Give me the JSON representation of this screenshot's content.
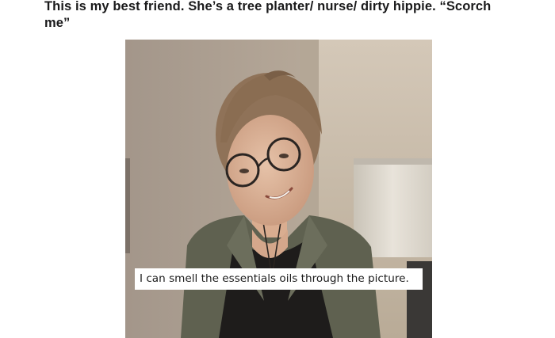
{
  "post": {
    "title": "This is my best friend. She’s a tree planter/ nurse/ dirty hippie. “Scorch me”"
  },
  "photo": {
    "caption": "I can smell the essentials oils through the picture."
  }
}
